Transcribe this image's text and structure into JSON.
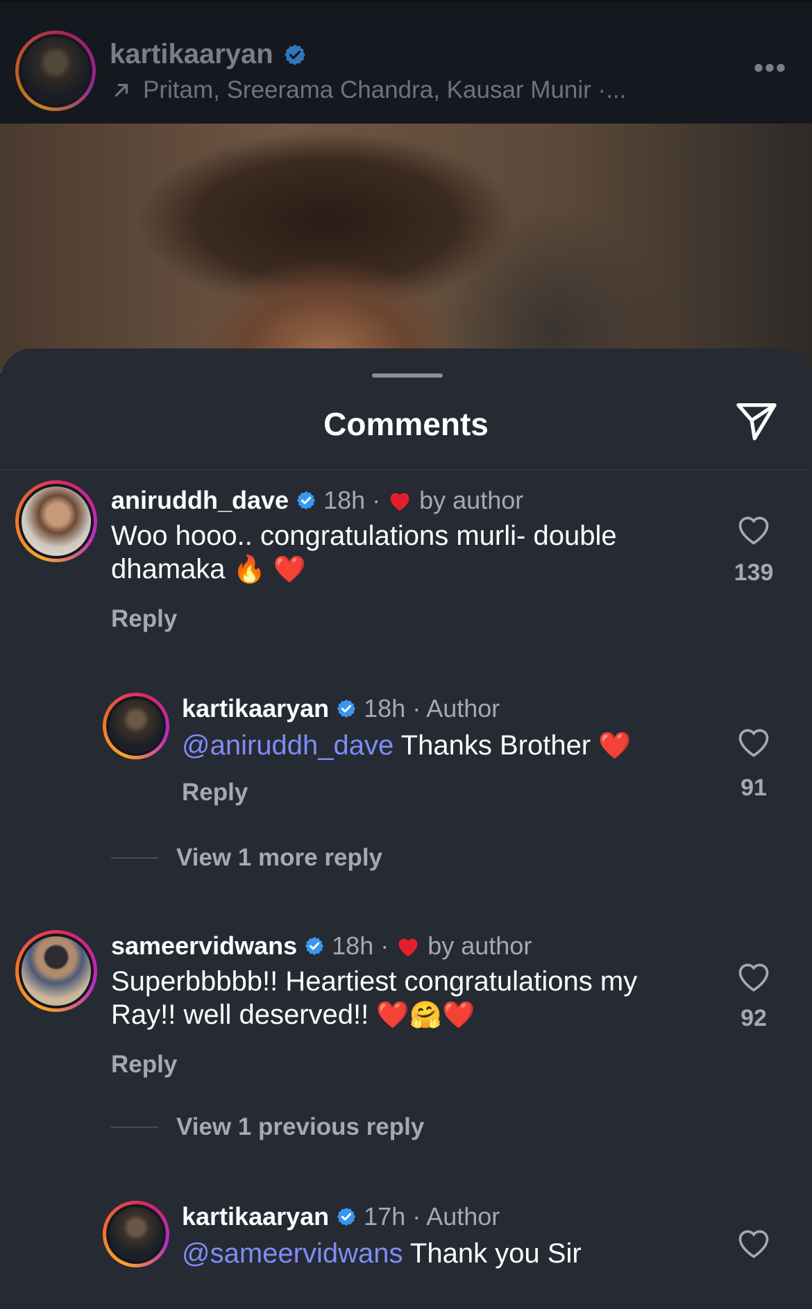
{
  "header": {
    "username": "kartikaaryan",
    "subtitle": "Pritam, Sreerama Chandra, Kausar Munir ·...",
    "more": "•••"
  },
  "sheet": {
    "title": "Comments"
  },
  "comments": [
    {
      "username": "aniruddh_dave",
      "time": "18h ·",
      "by_author": "by author",
      "text": "Woo hooo.. congratulations murli- double dhamaka",
      "emojis": "🔥 ❤️",
      "reply_label": "Reply",
      "likes": "139"
    },
    {
      "username": "kartikaaryan",
      "time": "18h · Author",
      "mention": "@aniruddh_dave",
      "text": "Thanks Brother",
      "emojis": "❤️",
      "reply_label": "Reply",
      "likes": "91"
    },
    {
      "username": "sameervidwans",
      "time": "18h ·",
      "by_author": "by author",
      "text": "Superbbbbb!! Heartiest congratulations my Ray!! well deserved!!",
      "emojis": "❤️🤗❤️",
      "reply_label": "Reply",
      "likes": "92"
    },
    {
      "username": "kartikaaryan",
      "time": "17h · Author",
      "mention": "@sameervidwans",
      "text": "Thank you Sir"
    }
  ],
  "view_more_1": "View 1 more reply",
  "view_prev_2": "View 1 previous reply",
  "colors": {
    "background": "#262a33",
    "mention": "#7f8cf6",
    "verified": "#3897f0",
    "like_red": "#e41f2d"
  }
}
